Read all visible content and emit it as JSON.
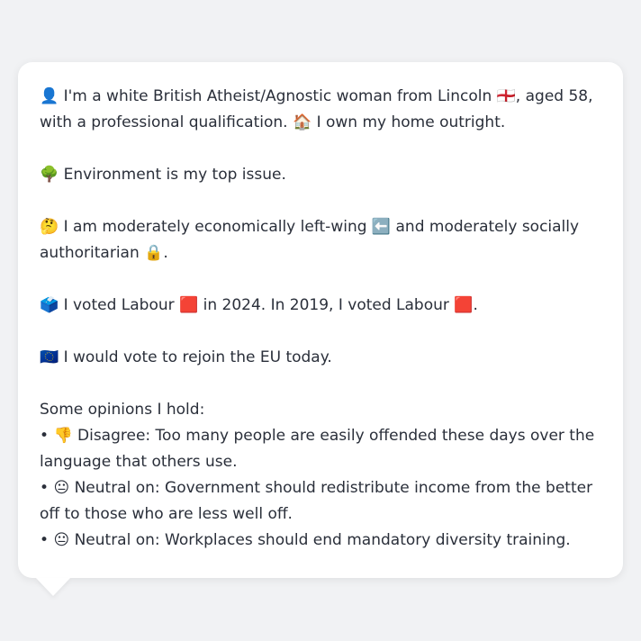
{
  "profile": {
    "p1_emoji_a": "👤",
    "p1_text_a": "I'm a white British Atheist/Agnostic woman from Lincoln",
    "p1_emoji_b": "🏴󠁧󠁢󠁥󠁮󠁧󠁿",
    "p1_text_b": ", aged 58, with a professional qualification.",
    "p1_emoji_c": "🏠",
    "p1_text_c": "I own my home outright.",
    "p2_emoji": "🌳",
    "p2_text": "Environment is my top issue.",
    "p3_emoji_a": "🤔",
    "p3_text_a": "I am moderately economically left-wing",
    "p3_emoji_b": "⬅️",
    "p3_text_b": "and moderately socially authoritarian",
    "p3_emoji_c": "🔒",
    "p3_text_c": ".",
    "p4_emoji_a": "🗳️",
    "p4_text_a": "I voted Labour",
    "p4_emoji_b": "🟥",
    "p4_text_b": "in 2024. In 2019, I voted Labour",
    "p4_emoji_c": "🟥",
    "p4_text_c": ".",
    "p5_emoji": "🇪🇺",
    "p5_text": "I would vote to rejoin the EU today.",
    "opinions_heading": "Some opinions I hold:",
    "opinions": [
      {
        "emoji": "👎",
        "text": "Disagree: Too many people are easily offended these days over the language that others use."
      },
      {
        "emoji": "😐",
        "text": "Neutral on: Government should redistribute income from the better off to those who are less well off."
      },
      {
        "emoji": "😐",
        "text": "Neutral on: Workplaces should end mandatory diversity training."
      }
    ]
  }
}
